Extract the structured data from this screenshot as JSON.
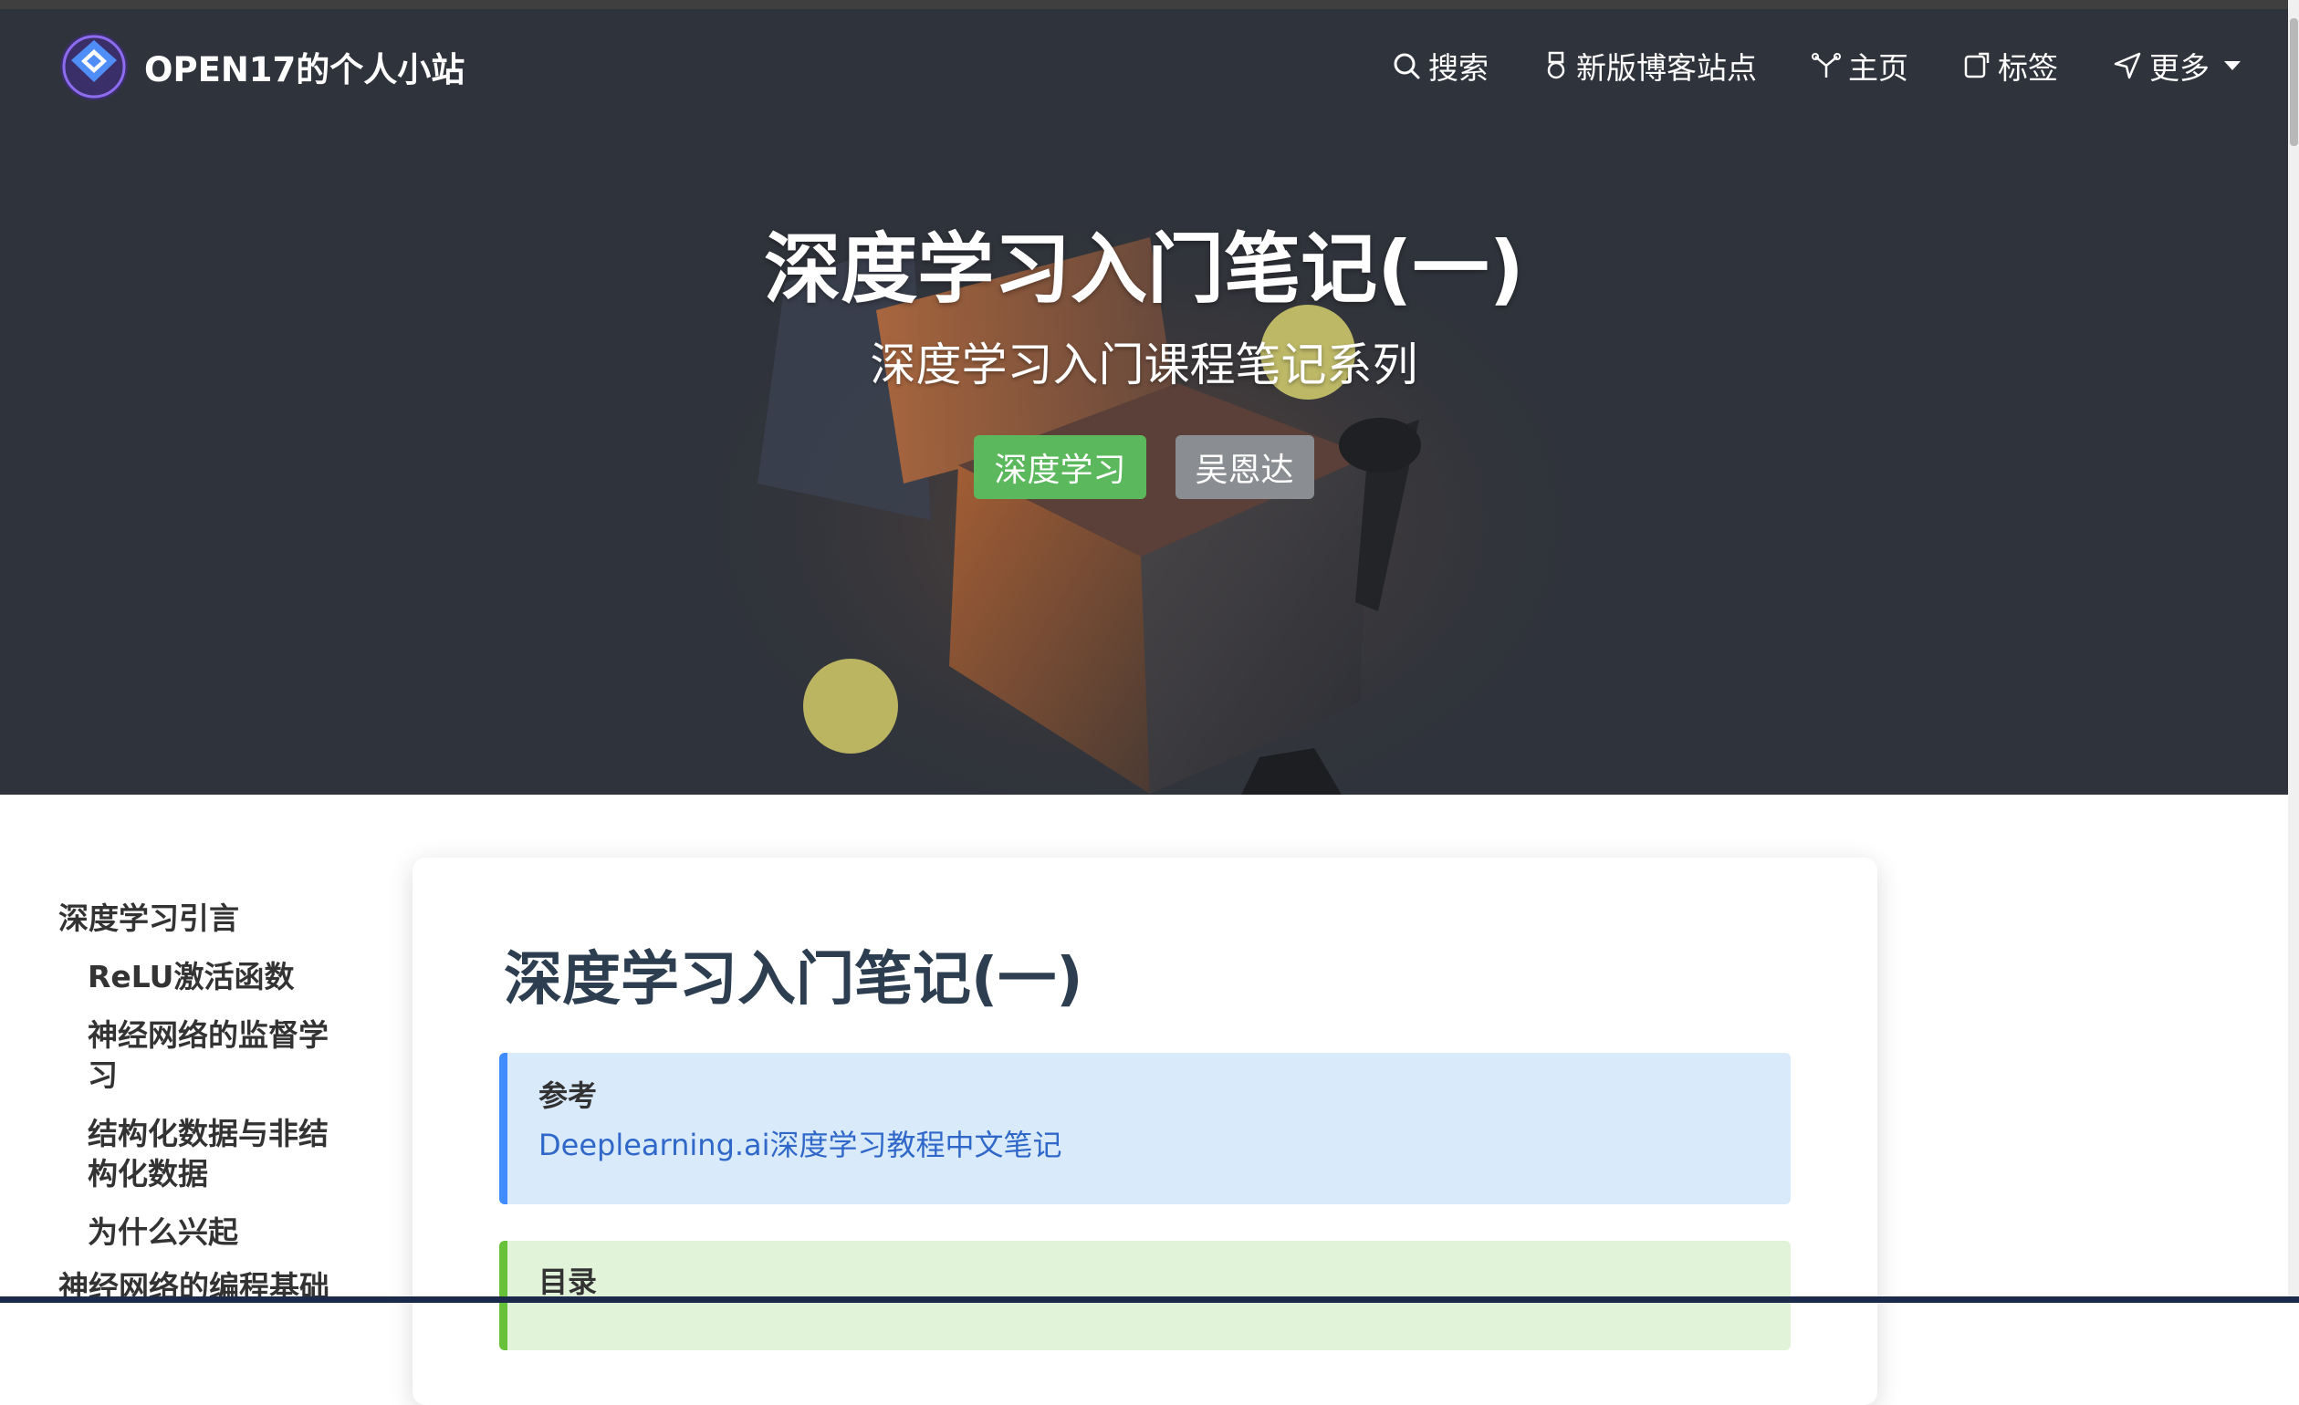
{
  "site": {
    "name": "OPEN17的个人小站"
  },
  "nav": {
    "items": [
      {
        "label": "搜索",
        "icon": "search-icon"
      },
      {
        "label": "新版博客站点",
        "icon": "medal-icon"
      },
      {
        "label": "主页",
        "icon": "home-icon"
      },
      {
        "label": "标签",
        "icon": "tag-icon"
      },
      {
        "label": "更多",
        "icon": "send-icon"
      }
    ]
  },
  "hero": {
    "title": "深度学习入门笔记(一)",
    "subtitle": "深度学习入门课程笔记系列",
    "tags": [
      "深度学习",
      "吴恩达"
    ]
  },
  "toc": {
    "items": [
      {
        "label": "深度学习引言",
        "level": 1
      },
      {
        "label": "ReLU激活函数",
        "level": 2
      },
      {
        "label": "神经网络的监督学习",
        "level": 2
      },
      {
        "label": "结构化数据与非结构化数据",
        "level": 2
      },
      {
        "label": "为什么兴起",
        "level": 2
      },
      {
        "label": "神经网络的编程基础",
        "level": 1
      }
    ]
  },
  "post": {
    "title": "深度学习入门笔记(一)",
    "reference": {
      "title": "参考",
      "link_text": "Deeplearning.ai深度学习教程中文笔记"
    },
    "contents_title": "目录"
  },
  "colors": {
    "tag_green": "#5cb85c",
    "tag_gray": "#8a8d92",
    "note_blue": "#d9eafb",
    "note_green": "#e1f3d8",
    "link": "#2f68c8"
  }
}
